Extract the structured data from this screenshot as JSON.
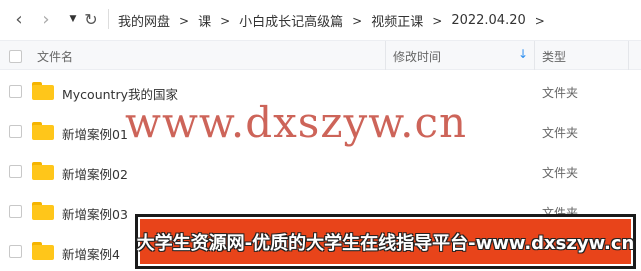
{
  "nav": {
    "back_icon": "‹",
    "forward_icon": "›",
    "dropdown_icon": "▼",
    "refresh_icon": "↻"
  },
  "breadcrumb": [
    "我的网盘",
    "课",
    "小白成长记高级篇",
    "视频正课",
    "2022.04.20"
  ],
  "breadcrumb_separator": ">",
  "columns": {
    "name": "文件名",
    "modified": "修改时间",
    "sort_icon": "↓",
    "type": "类型"
  },
  "files": [
    {
      "name": "Mycountry我的国家",
      "type": "文件夹"
    },
    {
      "name": "新增案例01",
      "type": "文件夹"
    },
    {
      "name": "新增案例02",
      "type": "文件夹"
    },
    {
      "name": "新增案例03",
      "type": "文件夹"
    },
    {
      "name": "新增案例4",
      "type": "文件夹"
    }
  ],
  "watermark": "www.dxszyw.cn",
  "banner": "大学生资源网-优质的大学生在线指导平台-www.dxszyw.cn",
  "colors": {
    "folder": "#ffc61a",
    "sort_accent": "#2e8ff0",
    "watermark": "#c0392b",
    "banner_bg": "#e8441a"
  }
}
